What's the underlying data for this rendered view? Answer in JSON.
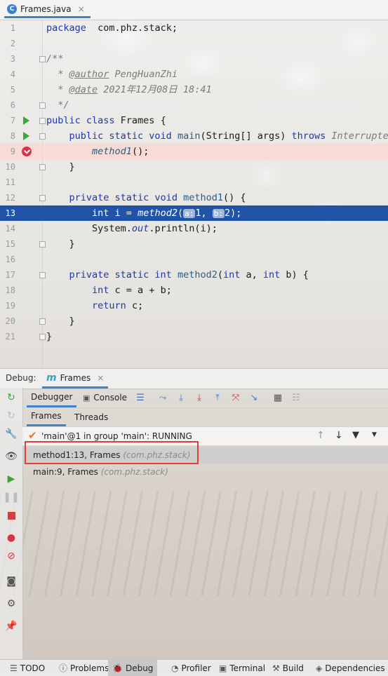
{
  "editor_tab": {
    "filename": "Frames.java",
    "icon": "c-class-icon"
  },
  "code_lines": [
    {
      "n": "1",
      "segs": [
        [
          "kw",
          "package"
        ],
        [
          "",
          "  com.phz.stack;"
        ]
      ]
    },
    {
      "n": "2",
      "segs": []
    },
    {
      "n": "3",
      "segs": [
        [
          "cm",
          "/**"
        ]
      ]
    },
    {
      "n": "4",
      "segs": [
        [
          "cm",
          "  * "
        ],
        [
          "tag",
          "@author"
        ],
        [
          "cm",
          " PengHuanZhi"
        ]
      ]
    },
    {
      "n": "5",
      "segs": [
        [
          "cm",
          "  * "
        ],
        [
          "tag",
          "@date"
        ],
        [
          "cm",
          " 2021年12月08日 18:41"
        ]
      ]
    },
    {
      "n": "6",
      "segs": [
        [
          "cm",
          "  */"
        ]
      ]
    },
    {
      "n": "7",
      "segs": [
        [
          "kw",
          "public class "
        ],
        [
          "",
          "Frames {"
        ]
      ]
    },
    {
      "n": "8",
      "segs": [
        [
          "",
          "    "
        ],
        [
          "kw",
          "public static void "
        ],
        [
          "fn",
          "main"
        ],
        [
          "",
          "(String[] args) "
        ],
        [
          "kw",
          "throws "
        ],
        [
          "cm",
          "Interrupted"
        ]
      ]
    },
    {
      "n": "9",
      "segs": [
        [
          "",
          "        "
        ],
        [
          "fn it",
          "method1"
        ],
        [
          "",
          "();"
        ]
      ]
    },
    {
      "n": "10",
      "segs": [
        [
          "",
          "    }"
        ]
      ]
    },
    {
      "n": "11",
      "segs": []
    },
    {
      "n": "12",
      "segs": [
        [
          "",
          "    "
        ],
        [
          "kw",
          "private static void "
        ],
        [
          "fn",
          "method1"
        ],
        [
          "",
          "() {"
        ]
      ]
    },
    {
      "n": "13",
      "segs": [
        [
          "",
          "        "
        ],
        [
          "kw",
          "int "
        ],
        [
          "",
          "i = "
        ],
        [
          "fn it",
          "method2"
        ],
        [
          "",
          "("
        ],
        [
          "hint",
          "a:"
        ],
        [
          "",
          "1, "
        ],
        [
          "hint",
          "b:"
        ],
        [
          "",
          "2);"
        ]
      ]
    },
    {
      "n": "14",
      "segs": [
        [
          "",
          "        System."
        ],
        [
          "it kw",
          "out"
        ],
        [
          "",
          ".println(i);"
        ]
      ]
    },
    {
      "n": "15",
      "segs": [
        [
          "",
          "    }"
        ]
      ]
    },
    {
      "n": "16",
      "segs": []
    },
    {
      "n": "17",
      "segs": [
        [
          "",
          "    "
        ],
        [
          "kw",
          "private static int "
        ],
        [
          "fn",
          "method2"
        ],
        [
          "",
          "("
        ],
        [
          "kw",
          "int "
        ],
        [
          "",
          "a, "
        ],
        [
          "kw",
          "int "
        ],
        [
          "",
          "b) {"
        ]
      ]
    },
    {
      "n": "18",
      "segs": [
        [
          "",
          "        "
        ],
        [
          "kw",
          "int "
        ],
        [
          "",
          "c = a + b;"
        ]
      ]
    },
    {
      "n": "19",
      "segs": [
        [
          "",
          "        "
        ],
        [
          "kw",
          "return "
        ],
        [
          "",
          "c;"
        ]
      ]
    },
    {
      "n": "20",
      "segs": [
        [
          "",
          "    }"
        ]
      ]
    },
    {
      "n": "21",
      "segs": [
        [
          "",
          "}"
        ]
      ]
    }
  ],
  "debug": {
    "label": "Debug:",
    "config_tab": "Frames",
    "debugger_tab": "Debugger",
    "console_tab": "Console",
    "frames_tab": "Frames",
    "threads_tab": "Threads",
    "thread_status": "'main'@1 in group 'main': RUNNING",
    "frames": [
      {
        "location": "method1:13, Frames",
        "package": "(com.phz.stack)",
        "selected": true
      },
      {
        "location": "main:9, Frames",
        "package": "(com.phz.stack)",
        "selected": false
      }
    ]
  },
  "status_bar": [
    {
      "label": "TODO",
      "icon": "list-icon"
    },
    {
      "label": "Problems",
      "icon": "problems-icon"
    },
    {
      "label": "Debug",
      "icon": "bug-icon",
      "active": true
    },
    {
      "label": "Profiler",
      "icon": "profiler-icon"
    },
    {
      "label": "Terminal",
      "icon": "terminal-icon"
    },
    {
      "label": "Build",
      "icon": "hammer-icon"
    },
    {
      "label": "Dependencies",
      "icon": "dependencies-icon"
    }
  ],
  "colors": {
    "accent": "#4083c9",
    "current_line": "#2153a8",
    "breakpoint": "#d6334a",
    "run": "#38a838",
    "highlight_box": "#e0403c"
  }
}
